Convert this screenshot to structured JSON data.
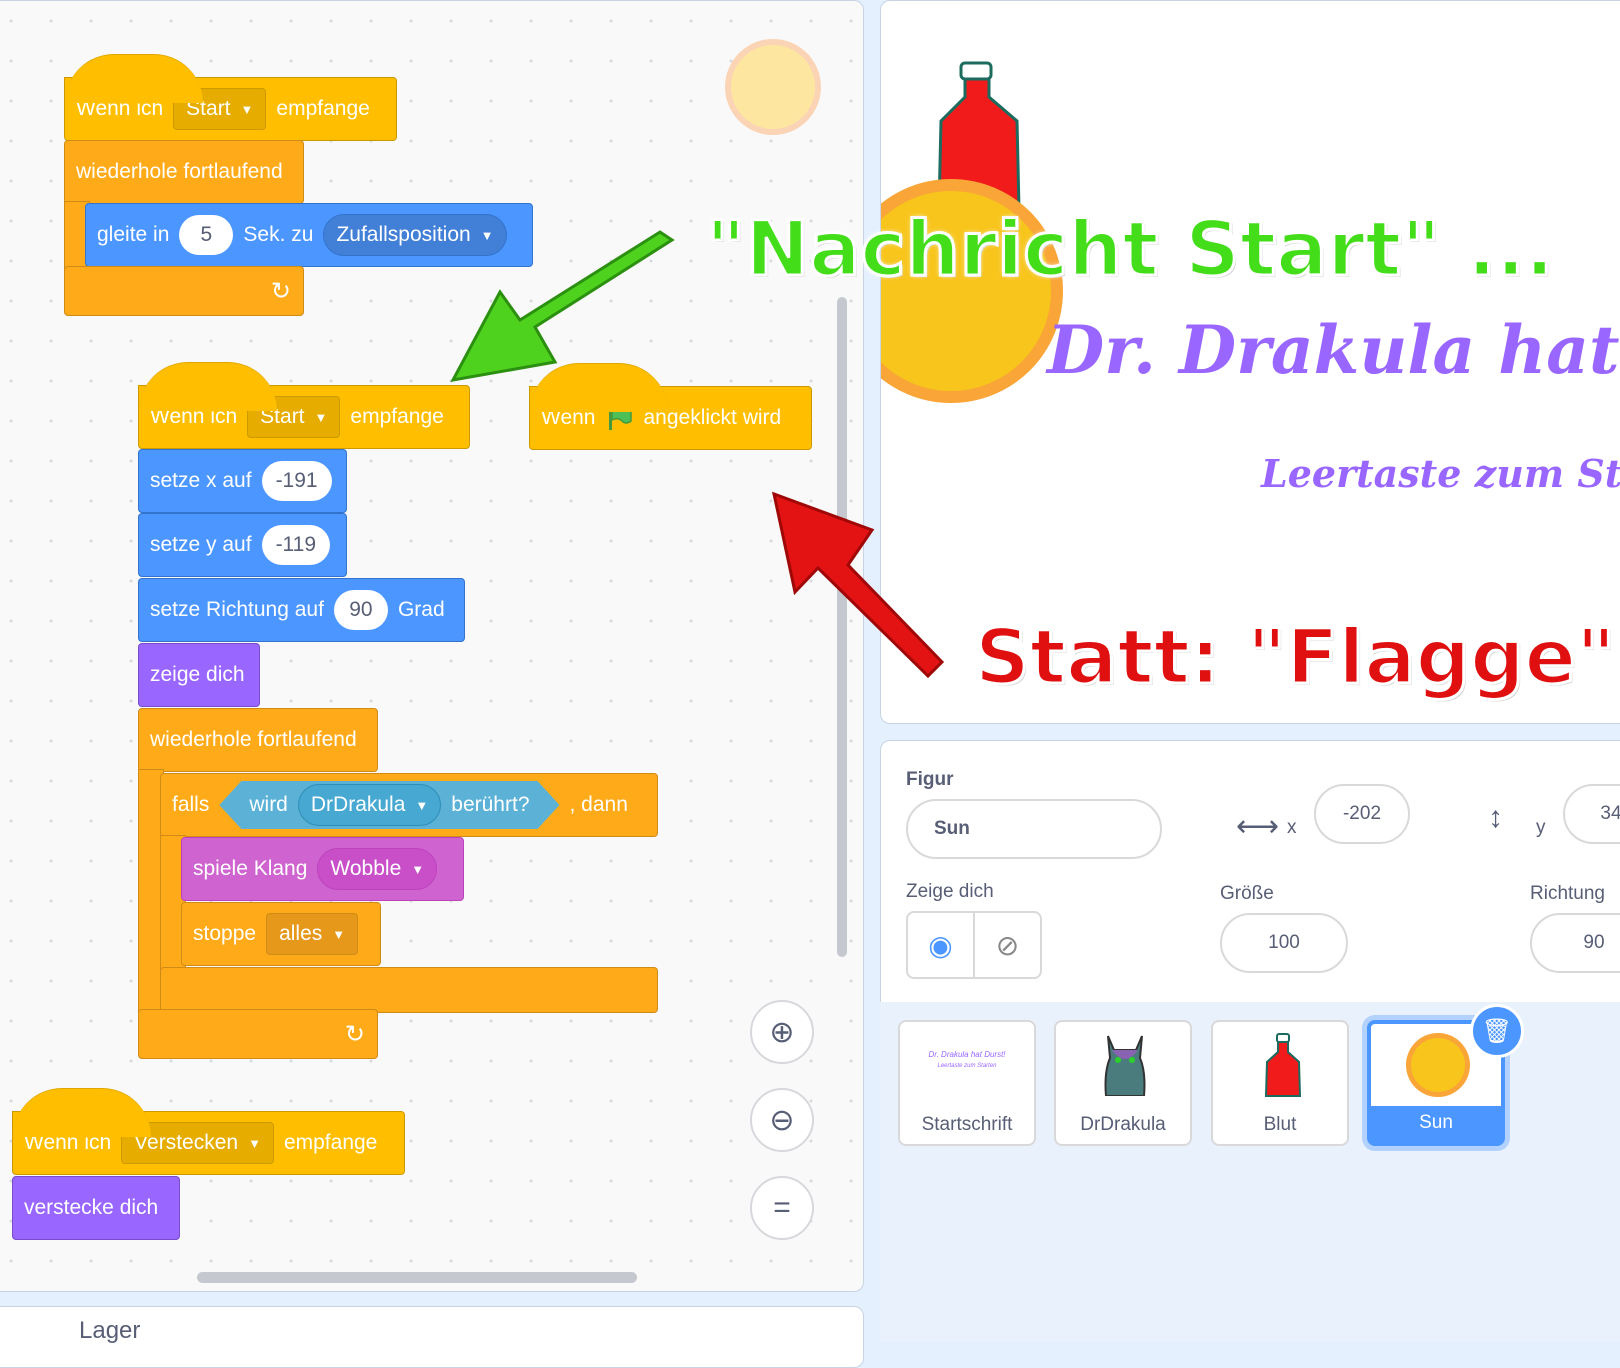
{
  "scripts": {
    "s1": {
      "hat_pre": "Wenn ich",
      "hat_msg": "Start",
      "hat_post": "empfange",
      "forever": "wiederhole fortlaufend",
      "glide_pre": "gleite in",
      "glide_secs": "5",
      "glide_mid": "Sek. zu",
      "glide_target": "Zufallsposition"
    },
    "s2": {
      "hat_pre": "Wenn ich",
      "hat_msg": "Start",
      "hat_post": "empfange",
      "setx_label": "setze x auf",
      "setx_val": "-191",
      "sety_label": "setze y auf",
      "sety_val": "-119",
      "dir_label": "setze Richtung auf",
      "dir_val": "90",
      "dir_unit": "Grad",
      "show": "zeige dich",
      "forever": "wiederhole fortlaufend",
      "if_pre": "falls",
      "touch_pre": "wird",
      "touch_target": "DrDrakula",
      "touch_post": "berührt?",
      "if_post": ", dann",
      "sound_label": "spiele Klang",
      "sound_name": "Wobble",
      "stop_label": "stoppe",
      "stop_opt": "alles"
    },
    "s3": {
      "pre": "Wenn",
      "post": "angeklickt wird"
    },
    "s4": {
      "hat_pre": "Wenn ich",
      "hat_msg": "Verstecken",
      "hat_post": "empfange",
      "hide": "verstecke dich"
    }
  },
  "annotations": {
    "green": "\"Nachricht Start\" ...",
    "red": "Statt: \"Flagge\"",
    "green_color": "#44dd1a",
    "red_color": "#e01010"
  },
  "stage": {
    "title": "Dr. Drakula hat D",
    "subtitle": "Leertaste zum Star"
  },
  "sprite_info": {
    "figur_label": "Figur",
    "figur_value": "Sun",
    "x_label": "x",
    "x_value": "-202",
    "y_label": "y",
    "y_value": "34",
    "show_label": "Zeige dich",
    "size_label": "Größe",
    "size_value": "100",
    "dir_label": "Richtung",
    "dir_value": "90"
  },
  "sprites": [
    {
      "name": "Startschrift",
      "thumb_text": "Dr. Drakula hat Durst!",
      "thumb_sub": "Leertaste zum Starten"
    },
    {
      "name": "DrDrakula"
    },
    {
      "name": "Blut"
    },
    {
      "name": "Sun",
      "selected": true
    }
  ],
  "lager_label": "Lager",
  "colors": {
    "events": "#ffbf00",
    "control": "#ffab19",
    "motion": "#4c97ff",
    "looks": "#9966ff",
    "sound": "#cf63cf",
    "sensing": "#5cb1d6",
    "selected": "#4c97ff"
  }
}
